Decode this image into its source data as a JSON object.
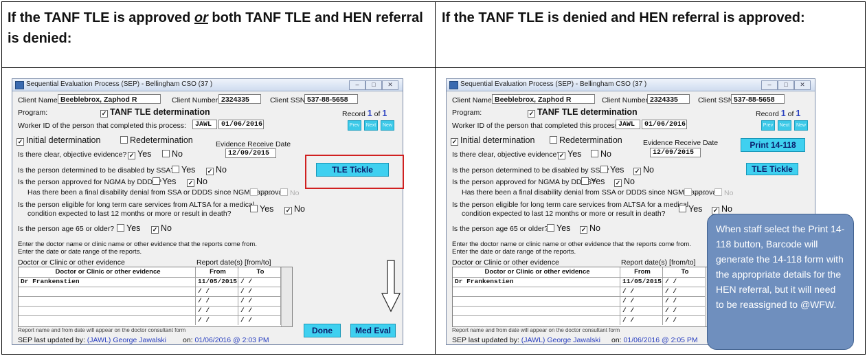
{
  "left_header": {
    "pre": "If the TANF TLE is approved ",
    "em": "or",
    "post": " both TANF TLE and HEN referral is denied:"
  },
  "right_header": "If the TANF TLE is denied and HEN referral is approved:",
  "left_window": {
    "title": "Sequential Evaluation Process (SEP) - Bellingham CSO (37 )",
    "client_name_label": "Client Name:",
    "client_name": "Beeblebrox, Zaphod R",
    "client_number_label": "Client Number:",
    "client_number": "2324335",
    "client_ssn_label": "Client SSN:",
    "client_ssn": "537-88-5658",
    "program_label": "Program:",
    "program_value": "TANF TLE determination",
    "record_label": "Record",
    "record_num": "1",
    "record_of": "of",
    "record_total": "1",
    "nav": [
      "Prev",
      "Next",
      "New"
    ],
    "worker_label": "Worker ID of the person that completed this process:",
    "worker_id": "JAWL",
    "worker_date": "01/06/2016",
    "initial_label": "Initial determination",
    "redetermination_label": "Redetermination",
    "evidence_receive_label": "Evidence Receive Date",
    "evidence_receive_date": "12/09/2015",
    "q_clear": "Is there clear, objective evidence?",
    "q_ssa": "Is the person determined to be disabled by SSA?",
    "q_ngma": "Is the person approved for NGMA by DDDS?",
    "q_final": "Has there been a final disability denial from SSA or DDDS since NGMA approval?",
    "q_ltc_1": "Is the person eligible for long term care services from ALTSA for a medical",
    "q_ltc_2": "condition expected to last 12 months or more or result in death?",
    "q_age": "Is the person age 65 or older?",
    "yes": "Yes",
    "no": "No",
    "instr_1": "Enter the doctor name or clinic name or other evidence that the reports come from.",
    "instr_2": "Enter the date or date range of the reports.",
    "doctor_col_label": "Doctor or Clinic or other evidence",
    "report_col_label": "Report date(s) [from/to]",
    "grid_headers": [
      "Doctor or Clinic or other evidence",
      "From",
      "To"
    ],
    "grid_rows": [
      {
        "doctor": "Dr Frankenstien",
        "from": "11/05/2015",
        "to": "/ /"
      },
      {
        "doctor": "",
        "from": "/ /",
        "to": "/ /"
      },
      {
        "doctor": "",
        "from": "/ /",
        "to": "/ /"
      },
      {
        "doctor": "",
        "from": "/ /",
        "to": "/ /"
      },
      {
        "doctor": "",
        "from": "/ /",
        "to": "/ /"
      }
    ],
    "footnote": "Report name and from date will appear on the doctor consultant form",
    "tle_tickle": "TLE Tickle",
    "done": "Done",
    "med_eval": "Med Eval",
    "updated_label": "SEP last updated by:",
    "updated_by_id": "(JAWL)",
    "updated_by_name": "George Jawalski",
    "updated_on_label": "on:",
    "updated_on": "01/06/2016 @ 2:03 PM"
  },
  "right_window": {
    "title": "Sequential Evaluation Process (SEP) - Bellingham CSO (37 )",
    "client_name_label": "Client Name:",
    "client_name": "Beeblebrox, Zaphod R",
    "client_number_label": "Client Number:",
    "client_number": "2324335",
    "client_ssn_label": "Client SSN:",
    "client_ssn": "537-88-5658",
    "program_label": "Program:",
    "program_value": "TANF TLE determination",
    "record_label": "Record",
    "record_num": "1",
    "record_of": "of",
    "record_total": "1",
    "nav": [
      "Prev",
      "Next",
      "New"
    ],
    "worker_label": "Worker ID of the person that completed this process:",
    "worker_id": "JAWL",
    "worker_date": "01/06/2016",
    "initial_label": "Initial determination",
    "redetermination_label": "Redetermination",
    "evidence_receive_label": "Evidence Receive Date",
    "evidence_receive_date": "12/09/2015",
    "q_clear": "Is there clear, objective evidence?",
    "q_ssa": "Is the person determined to be disabled by SSA?",
    "q_ngma": "Is the person approved for NGMA by DDDS?",
    "q_final": "Has there been a final disability denial from SSA or DDDS since NGMA approval?",
    "q_ltc_1": "Is the person eligible for long term care services from ALTSA for a medical",
    "q_ltc_2": "condition expected to last 12 months or more or result in death?",
    "q_age": "Is the person age 65 or older?",
    "yes": "Yes",
    "no": "No",
    "instr_1": "Enter the doctor name or clinic name or other evidence that the reports come from.",
    "instr_2": "Enter the date or date range of the reports.",
    "doctor_col_label": "Doctor or Clinic or other evidence",
    "report_col_label": "Report date(s) [from/to]",
    "grid_headers": [
      "Doctor or Clinic or other evidence",
      "From",
      "To"
    ],
    "grid_rows": [
      {
        "doctor": "Dr Frankenstien",
        "from": "11/05/2015",
        "to": "/ /"
      },
      {
        "doctor": "",
        "from": "/ /",
        "to": "/ /"
      },
      {
        "doctor": "",
        "from": "/ /",
        "to": "/ /"
      },
      {
        "doctor": "",
        "from": "/ /",
        "to": "/ /"
      },
      {
        "doctor": "",
        "from": "/ /",
        "to": "/ /"
      }
    ],
    "footnote": "Report name and from date will appear on the doctor consultant form",
    "print_btn": "Print 14-118",
    "tle_tickle": "TLE Tickle",
    "updated_label": "SEP last updated by:",
    "updated_by_id": "(JAWL)",
    "updated_by_name": "George Jawalski",
    "updated_on_label": "on:",
    "updated_on": "01/06/2016 @ 2:05 PM"
  },
  "callout": "When staff select the Print 14-118 button, Barcode will generate the 14-118 form with the appropriate details for the HEN referral, but it will need to be reassigned to @WFW.",
  "colors": {
    "accent_button": "#3fd0f0",
    "highlight_border": "#d02020",
    "callout_bg": "#6f8fbe"
  }
}
